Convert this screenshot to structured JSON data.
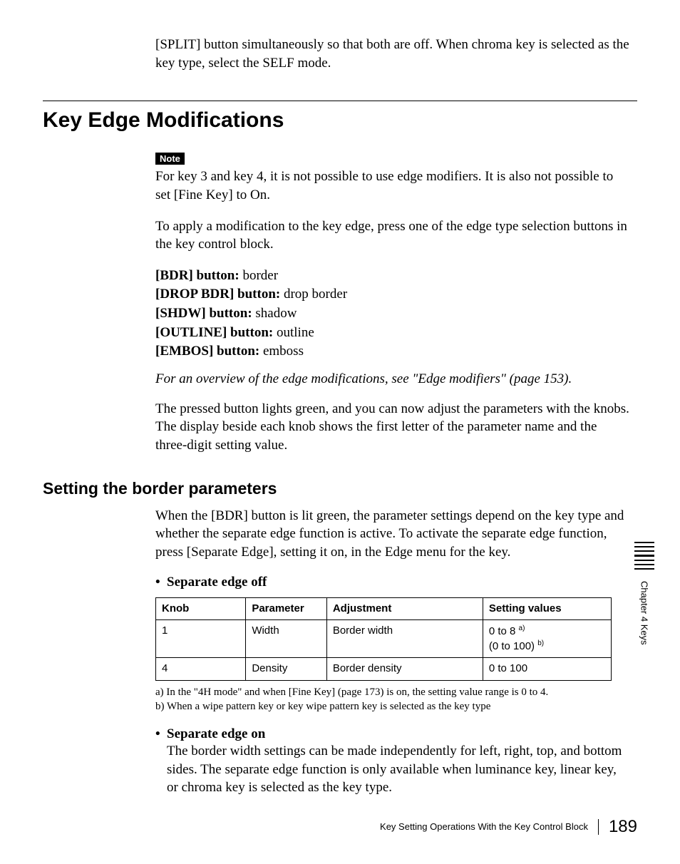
{
  "intro_top": "[SPLIT] button simultaneously so that both are off. When chroma key is selected as the key type, select the SELF mode.",
  "h1": "Key Edge Modifications",
  "note_label": "Note",
  "note_text": "For key 3 and key 4, it is not possible to use edge modifiers. It is also not possible to set [Fine Key] to On.",
  "apply_text": "To apply a modification to the key edge, press one of the edge type selection buttons in the key control block.",
  "defs": {
    "bdr": {
      "term": "[BDR] button:",
      "desc": " border"
    },
    "dropbdr": {
      "term": "[DROP BDR] button:",
      "desc": " drop border"
    },
    "shdw": {
      "term": "[SHDW] button:",
      "desc": " shadow"
    },
    "outline": {
      "term": "[OUTLINE] button:",
      "desc": " outline"
    },
    "embos": {
      "term": "[EMBOS] button:",
      "desc": " emboss"
    }
  },
  "overview_ref": "For an overview of the edge modifications, see \"Edge modifiers\" (page 153).",
  "pressed_text": "The pressed button lights green, and you can now adjust the parameters with the knobs. The display beside each knob shows the first letter of the parameter name and the three-digit setting value.",
  "h2": "Setting the border parameters",
  "border_intro": "When the [BDR] button is lit green, the parameter settings depend on the key type and whether the separate edge function is active. To activate the separate edge function, press [Separate Edge], setting it on, in the Edge menu for the key.",
  "sep_off_label": "Separate edge off",
  "table": {
    "headers": {
      "knob": "Knob",
      "param": "Parameter",
      "adj": "Adjustment",
      "set": "Setting values"
    },
    "rows": [
      {
        "knob": "1",
        "param": "Width",
        "adj": "Border width",
        "set_line1_pre": "0 to 8 ",
        "set_line1_sup": "a)",
        "set_line2_pre": "(0 to 100) ",
        "set_line2_sup": "b)"
      },
      {
        "knob": "4",
        "param": "Density",
        "adj": "Border density",
        "set_line1_pre": "0 to 100",
        "set_line1_sup": "",
        "set_line2_pre": "",
        "set_line2_sup": ""
      }
    ]
  },
  "footnote_a": "a) In the \"4H mode\" and when [Fine Key] (page 173) is on, the setting value range is 0 to 4.",
  "footnote_b": "b) When a wipe pattern key or key wipe pattern key is selected as the key type",
  "sep_on_label": "Separate edge on",
  "sep_on_text": "The border width settings can be made independently for left, right, top, and bottom sides. The separate edge function is only available when luminance key, linear key, or chroma key is selected as the key type.",
  "side_label": "Chapter 4  Keys",
  "footer_text": "Key Setting Operations With the Key Control Block",
  "footer_page": "189"
}
